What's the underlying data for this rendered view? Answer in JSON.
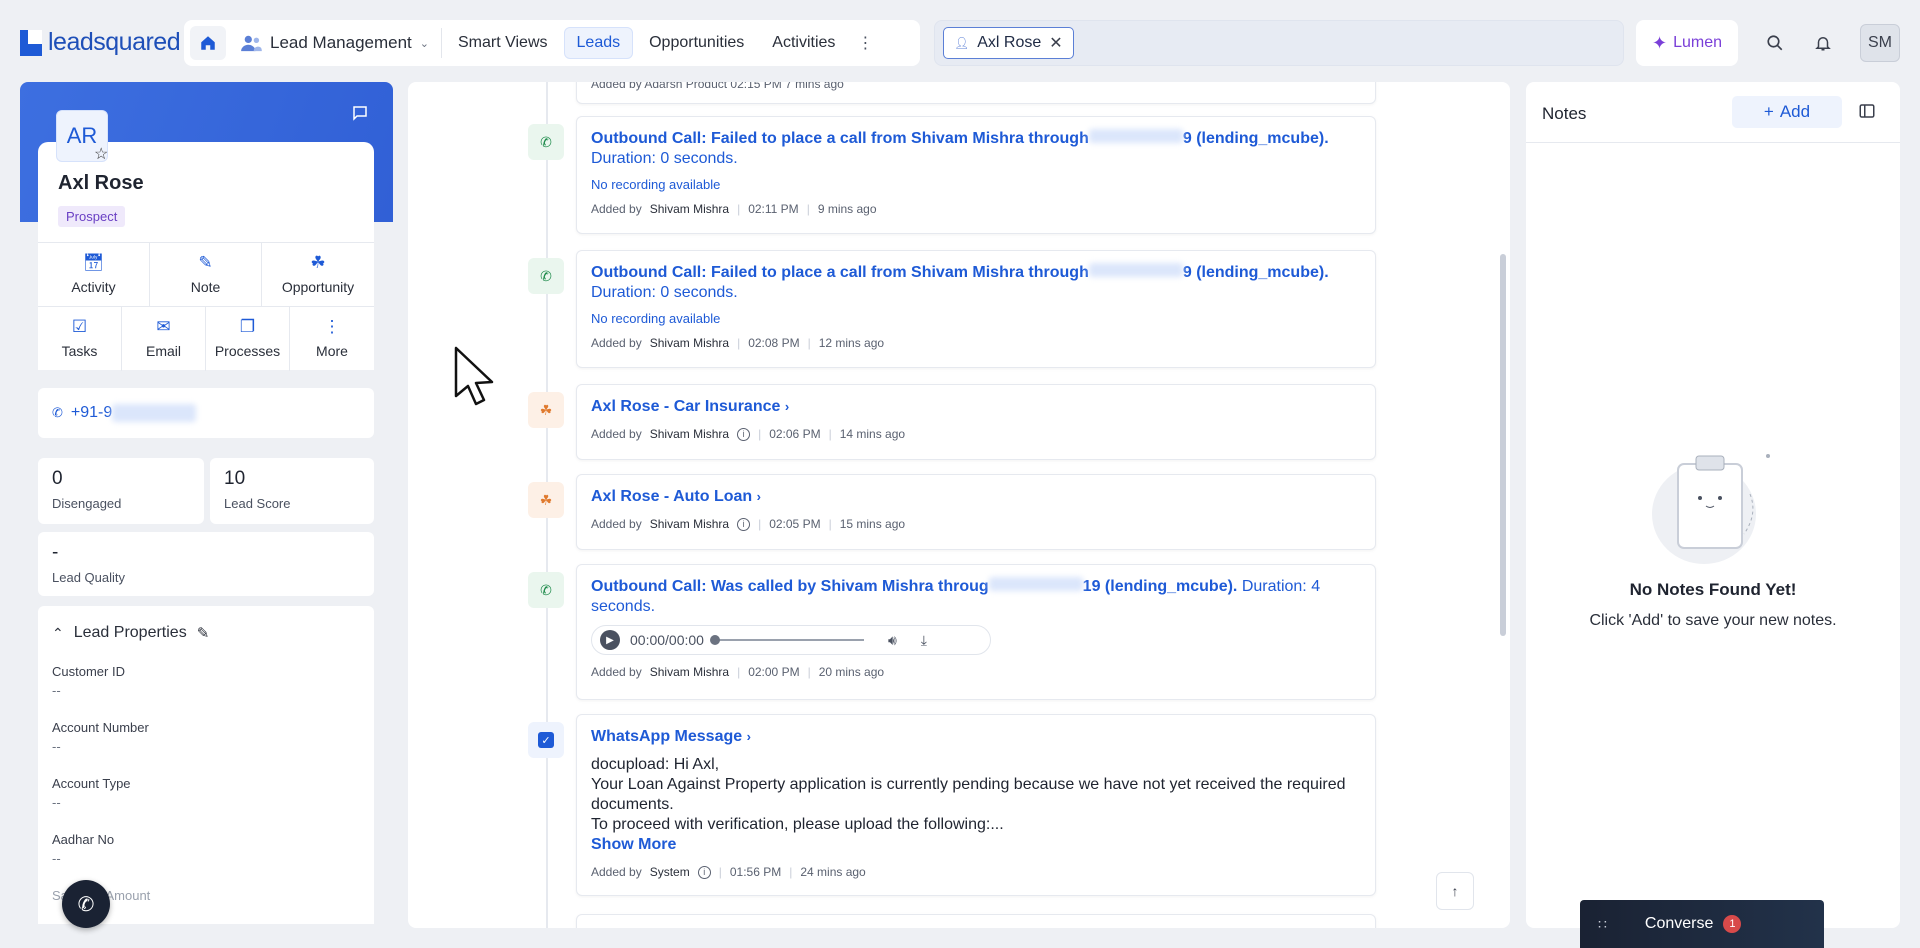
{
  "topbar": {
    "logo_text": "leadsquared",
    "module": "Lead Management",
    "tabs": [
      {
        "label": "Smart Views",
        "active": false
      },
      {
        "label": "Leads",
        "active": true
      },
      {
        "label": "Opportunities",
        "active": false
      },
      {
        "label": "Activities",
        "active": false
      }
    ],
    "search_chip": "Axl Rose",
    "lumen_label": "Lumen",
    "user_initials": "SM"
  },
  "lead": {
    "initials": "AR",
    "name": "Axl Rose",
    "stage": "Prospect",
    "actions_row1": [
      "Activity",
      "Note",
      "Opportunity"
    ],
    "actions_row2": [
      "Tasks",
      "Email",
      "Processes",
      "More"
    ],
    "phone_prefix": "+91-9",
    "engagement_value": "0",
    "engagement_label": "Disengaged",
    "score_value": "10",
    "score_label": "Lead Score",
    "quality_value": "-",
    "quality_label": "Lead Quality",
    "properties_title": "Lead Properties",
    "properties": [
      {
        "key": "Customer ID",
        "value": "--"
      },
      {
        "key": "Account Number",
        "value": "--"
      },
      {
        "key": "Account Type",
        "value": "--"
      },
      {
        "key": "Aadhar No",
        "value": "--"
      },
      {
        "key": "Sanction Amount",
        "value": ""
      }
    ]
  },
  "timeline": {
    "top_partial": {
      "meta": "Added by Adarsh Product  02:15 PM  7 mins ago"
    },
    "entries": [
      {
        "title_a": "Outbound Call: Failed to place a call from Shivam Mishra through",
        "title_b": "9 (lending_mcube).",
        "sub": "Duration: 0 seconds.",
        "note": "No recording available",
        "added_by": "Added by",
        "who": "Shivam Mishra",
        "time": "02:11 PM",
        "ago": "9 mins ago"
      },
      {
        "title_a": "Outbound Call: Failed to place a call from Shivam Mishra through",
        "title_b": "9 (lending_mcube).",
        "sub": "Duration: 0 seconds.",
        "note": "No recording available",
        "added_by": "Added by",
        "who": "Shivam Mishra",
        "time": "02:08 PM",
        "ago": "12 mins ago"
      },
      {
        "title": "Axl Rose - Car Insurance",
        "added_by": "Added by",
        "who": "Shivam Mishra",
        "time": "02:06 PM",
        "ago": "14 mins ago"
      },
      {
        "title": "Axl Rose - Auto Loan",
        "added_by": "Added by",
        "who": "Shivam Mishra",
        "time": "02:05 PM",
        "ago": "15 mins ago"
      },
      {
        "title_a": "Outbound Call: Was called by Shivam Mishra throug",
        "title_b": "19 (lending_mcube).",
        "sub_inline": "Duration: 4",
        "sub": "seconds.",
        "audio_time": "00:00/00:00",
        "added_by": "Added by",
        "who": "Shivam Mishra",
        "time": "02:00 PM",
        "ago": "20 mins ago"
      },
      {
        "title": "WhatsApp Message",
        "body_1": "docupload: Hi Axl,",
        "body_2": "Your Loan Against Property application is currently pending because we have not yet received the required documents.",
        "body_3": "To proceed with verification, please upload the following:...",
        "show_more": "Show More",
        "added_by": "Added by",
        "who": "System",
        "time": "01:56 PM",
        "ago": "24 mins ago"
      }
    ]
  },
  "notes": {
    "title": "Notes",
    "add_label": "Add",
    "empty_title": "No Notes Found Yet!",
    "empty_sub": "Click 'Add' to save your new notes."
  },
  "converse": {
    "label": "Converse",
    "count": "1"
  },
  "colors": {
    "brand": "#1e5ad6",
    "hero": "#3d6fe0",
    "stage": "#6a3fc4",
    "call": "#1d8a4a",
    "opportunity": "#e07a2e"
  }
}
